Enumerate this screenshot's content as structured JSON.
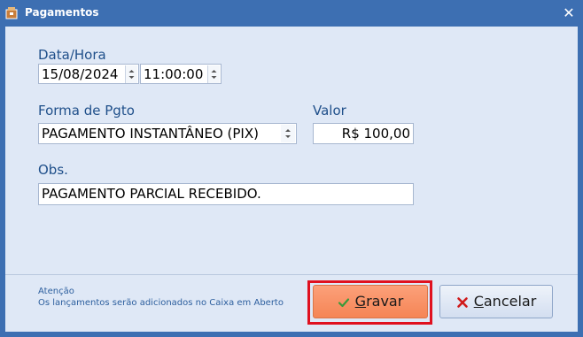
{
  "window": {
    "title": "Pagamentos",
    "close_glyph": "✕"
  },
  "datetime": {
    "label": "Data/Hora",
    "date": "15/08/2024",
    "time": "11:00:00"
  },
  "payment": {
    "label": "Forma de Pgto",
    "value": "PAGAMENTO INSTANTÂNEO (PIX)"
  },
  "amount": {
    "label": "Valor",
    "value": "R$ 100,00"
  },
  "obs": {
    "label": "Obs.",
    "value": "PAGAMENTO PARCIAL RECEBIDO."
  },
  "footer": {
    "note_title": "Atenção",
    "note_text": "Os lançamentos serão adicionados no Caixa em Aberto"
  },
  "buttons": {
    "save_label": "Gravar",
    "cancel_label": "Cancelar"
  },
  "colors": {
    "titlebar": "#3d6fb2",
    "client_bg": "#dfe8f6",
    "label_text": "#1f4f8a",
    "save_button": "#f58556",
    "focus_frame": "#e0101f"
  },
  "icons": [
    "app-icon",
    "close-icon",
    "spin-up-icon",
    "spin-down-icon",
    "dropdown-icon",
    "check-icon",
    "x-icon"
  ]
}
